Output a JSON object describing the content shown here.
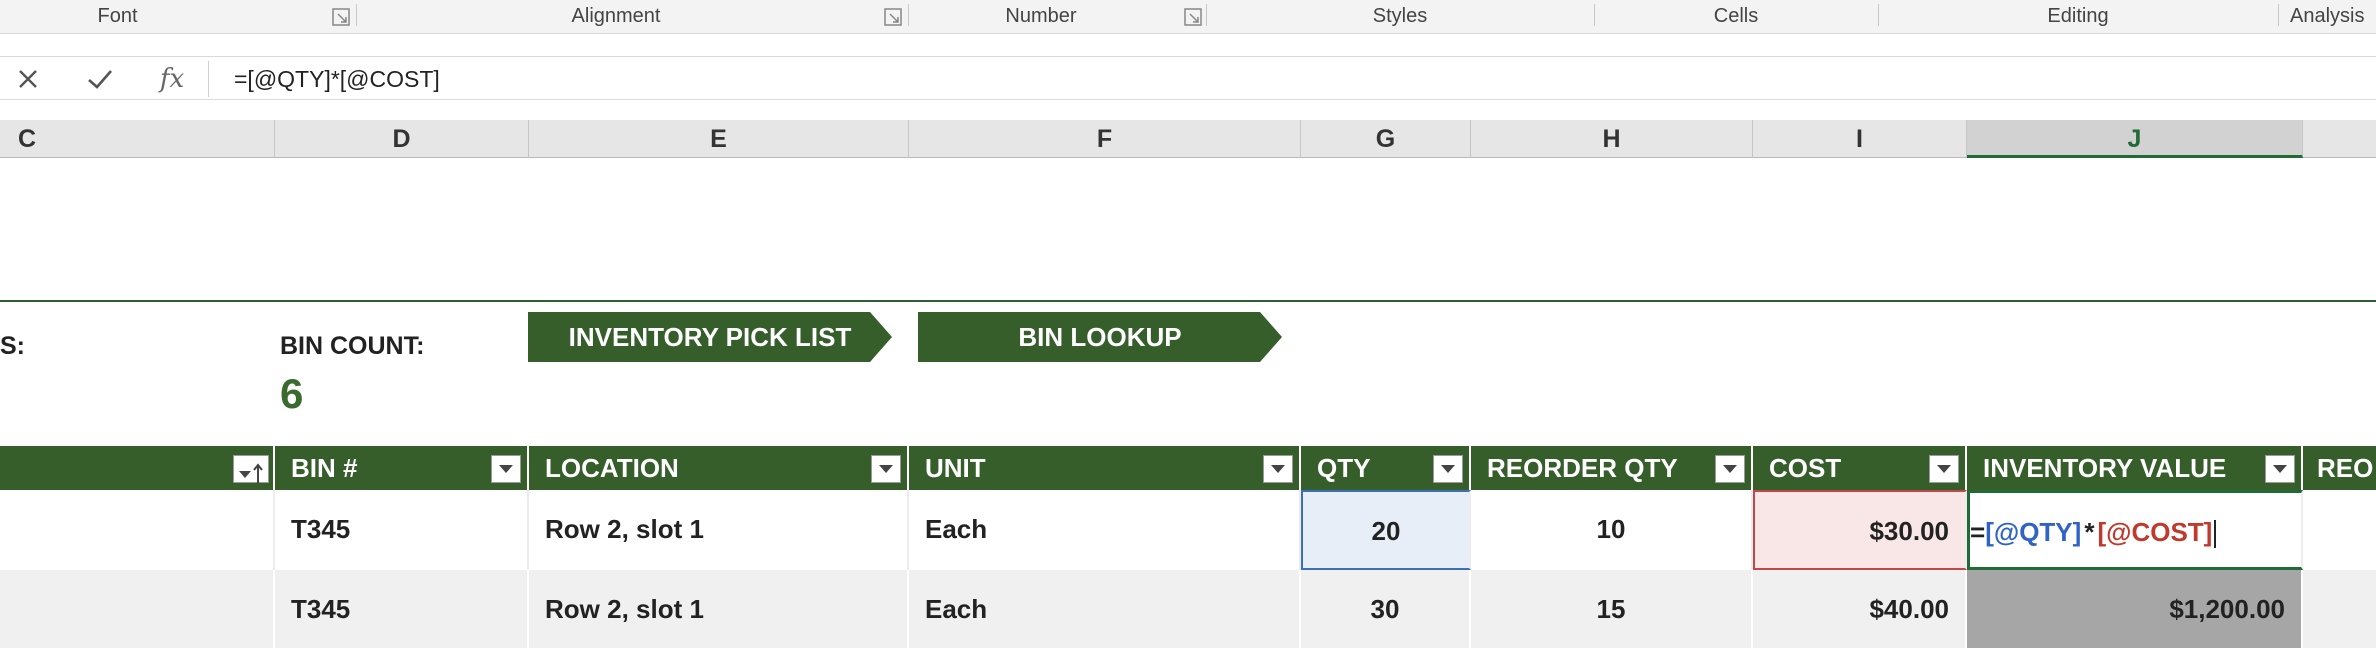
{
  "ribbon": {
    "groups": [
      "Font",
      "Alignment",
      "Number",
      "Styles",
      "Cells",
      "Editing",
      "Analysis"
    ]
  },
  "formula_bar": {
    "cancel_icon": "close-icon",
    "enter_icon": "check-icon",
    "fx_label": "fx",
    "formula": "=[@QTY]*[@COST]"
  },
  "columns": [
    "C",
    "D",
    "E",
    "F",
    "G",
    "H",
    "I",
    "J"
  ],
  "active_column": "J",
  "sheet": {
    "left_label": "S:",
    "bin_count_label": "BIN COUNT:",
    "bin_count_value": "6",
    "buttons": {
      "pick_list": "INVENTORY PICK LIST",
      "bin_lookup": "BIN LOOKUP"
    }
  },
  "table": {
    "headers": [
      "BIN #",
      "LOCATION",
      "UNIT",
      "QTY",
      "REORDER QTY",
      "COST",
      "INVENTORY VALUE",
      "REO"
    ],
    "rows": [
      {
        "bin": "T345",
        "location": "Row 2, slot 1",
        "unit": "Each",
        "qty": "20",
        "reorder_qty": "10",
        "cost": "$30.00",
        "inventory_value_formula": {
          "eq": "=",
          "ref1": "[@QTY]",
          "op": "*",
          "ref2": "[@COST]"
        }
      },
      {
        "bin": "T345",
        "location": "Row 2, slot 1",
        "unit": "Each",
        "qty": "30",
        "reorder_qty": "15",
        "cost": "$40.00",
        "inventory_value": "$1,200.00"
      }
    ]
  },
  "colors": {
    "table_header": "#355e2b",
    "accent_green": "#1f6b36",
    "ref_blue": "#2f63c7",
    "ref_red": "#c0392b"
  }
}
